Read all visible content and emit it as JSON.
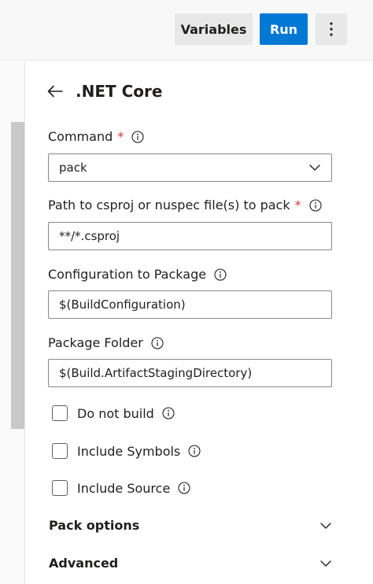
{
  "toolbar": {
    "variables_label": "Variables",
    "run_label": "Run",
    "more_icon": "more-vertical-icon"
  },
  "task": {
    "title": ".NET Core",
    "back_icon": "back-arrow-icon"
  },
  "fields": {
    "command": {
      "label": "Command",
      "required": "*",
      "value": "pack"
    },
    "path": {
      "label": "Path to csproj or nuspec file(s) to pack",
      "required": "*",
      "value": "**/*.csproj"
    },
    "configuration": {
      "label": "Configuration to Package",
      "value": "$(BuildConfiguration)"
    },
    "package_folder": {
      "label": "Package Folder",
      "value": "$(Build.ArtifactStagingDirectory)"
    }
  },
  "checkboxes": {
    "do_not_build": {
      "label": "Do not build",
      "checked": false
    },
    "include_symbols": {
      "label": "Include Symbols",
      "checked": false
    },
    "include_source": {
      "label": "Include Source",
      "checked": false
    }
  },
  "sections": {
    "pack_options": "Pack options",
    "advanced": "Advanced"
  },
  "colors": {
    "accent": "#0078d4",
    "required": "#d13438",
    "border": "#8a8886"
  }
}
